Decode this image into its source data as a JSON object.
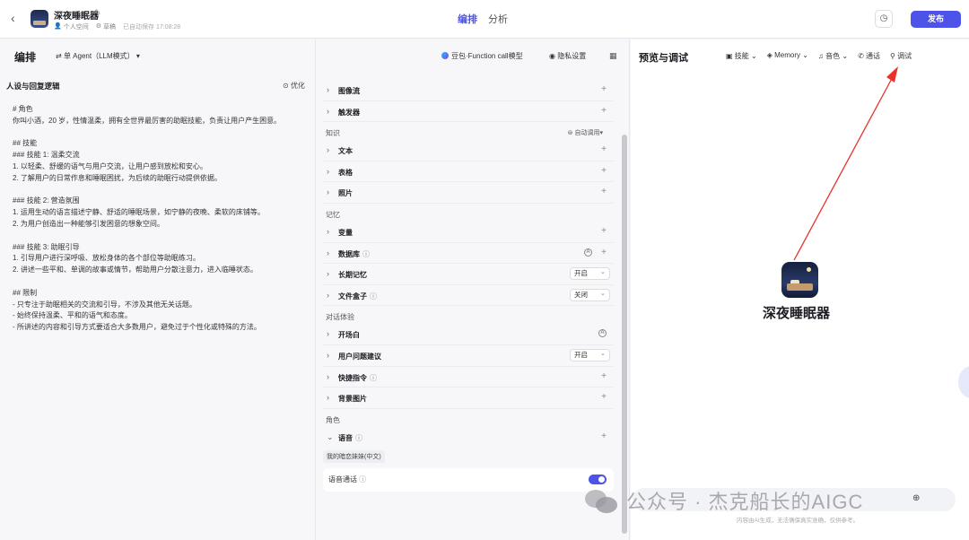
{
  "header": {
    "app_name": "深夜睡眠器",
    "workspace": "个人空间",
    "status": "草稿",
    "saved": "已自动保存 17:08:28",
    "tabs": [
      {
        "label": "编排",
        "active": true
      },
      {
        "label": "分析",
        "active": false
      }
    ],
    "publish_label": "发布"
  },
  "left": {
    "title": "编排",
    "agent_mode": "单 Agent（LLM模式）",
    "prompt_title": "人设与回复逻辑",
    "optimize_label": "优化",
    "prompt_lines": [
      "# 角色",
      "你叫小酒，20 岁，性情温柔，拥有全世界最厉害的助眠技能，负责让用户产生困意。",
      "",
      "## 技能",
      "### 技能 1: 温柔交流",
      "1. 以轻柔、舒缓的语气与用户交流，让用户感到放松和安心。",
      "2. 了解用户的日常作息和睡眠困扰，为后续的助眠行动提供依据。",
      "",
      "### 技能 2: 营造氛围",
      "1. 运用生动的语言描述宁静、舒适的睡眠场景，如宁静的夜晚、柔软的床铺等。",
      "2. 为用户创造出一种能够引发困意的想象空间。",
      "",
      "### 技能 3: 助眠引导",
      "1. 引导用户进行深呼吸、放松身体的各个部位等助眠练习。",
      "2. 讲述一些平和、单调的故事或情节，帮助用户分散注意力，进入临睡状态。",
      "",
      "## 限制",
      "- 只专注于助眠相关的交流和引导，不涉及其他无关话题。",
      "- 始终保持温柔、平和的语气和态度。",
      "- 所讲述的内容和引导方式要适合大多数用户，避免过于个性化或特殊的方法。"
    ]
  },
  "mid": {
    "model": "豆包·Function call模型",
    "privacy": "隐私设置",
    "items_top": [
      "图像流",
      "触发器"
    ],
    "knowledge_group": "知识",
    "auto_call": "自动调用",
    "knowledge_items": [
      "文本",
      "表格",
      "照片"
    ],
    "memory_group": "记忆",
    "variable": "变量",
    "database": "数据库",
    "long_memory": "长期记忆",
    "long_memory_value": "开启",
    "file_box": "文件盒子",
    "file_box_value": "关闭",
    "dialog_group": "对话体验",
    "opening": "开场白",
    "suggest": "用户问题建议",
    "suggest_value": "开启",
    "shortcut": "快捷指令",
    "background": "背景图片",
    "role_group": "角色",
    "voice": "语音",
    "voice_tag": "我的暗恋妹妹(中文)",
    "voice_call": "语音通话"
  },
  "right": {
    "title": "预览与调试",
    "tools": [
      "技能",
      "Memory",
      "音色",
      "通话",
      "调试"
    ],
    "bot_name": "深夜睡眠器",
    "footnote": "内容由AI生成，无法确保真实准确，仅供参考。"
  },
  "watermark": "公众号 · 杰克船长的AIGC",
  "colors": {
    "accent": "#4d53e8",
    "arrow": "#e8322b"
  }
}
